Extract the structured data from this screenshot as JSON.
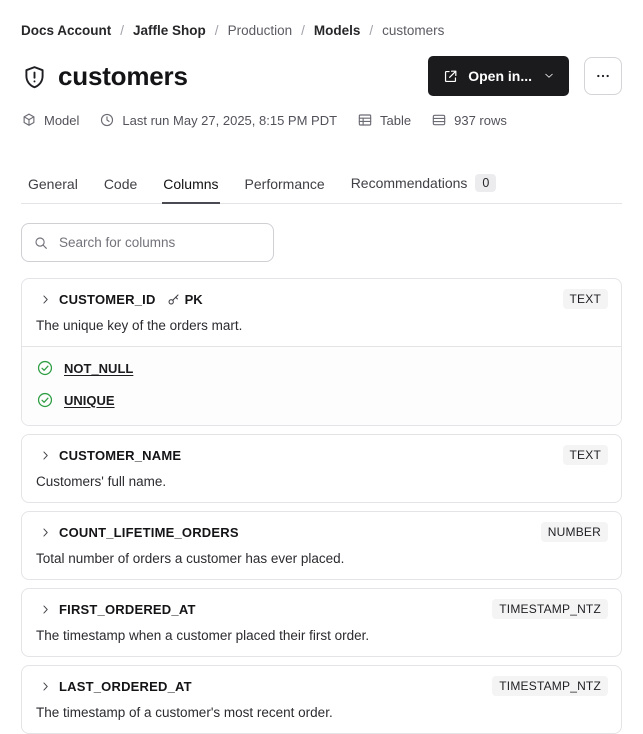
{
  "colors": {
    "accent_button_bg": "#1b1b1e",
    "test_pass_green": "#2f9e44",
    "badge_bg": "#f4f4f5",
    "border": "#e4e4e7"
  },
  "breadcrumb": {
    "separator": "/",
    "items": [
      {
        "label": "Docs Account",
        "style": "strong"
      },
      {
        "label": "Jaffle Shop",
        "style": "strong"
      },
      {
        "label": "Production",
        "style": "muted"
      },
      {
        "label": "Models",
        "style": "strong"
      },
      {
        "label": "customers",
        "style": "muted"
      }
    ]
  },
  "header": {
    "title": "customers",
    "title_icon": "shield-alert-icon",
    "open_in": {
      "label": "Open in...",
      "icon": "external-link-icon",
      "chevron": "chevron-down-icon"
    },
    "more_button_icon": "ellipsis-icon",
    "meta": [
      {
        "icon": "cube-icon",
        "label": "Model"
      },
      {
        "icon": "clock-icon",
        "label": "Last run May 27, 2025, 8:15 PM PDT"
      },
      {
        "icon": "table-icon",
        "label": "Table"
      },
      {
        "icon": "database-icon",
        "label": "937 rows"
      }
    ]
  },
  "tabs": {
    "items": [
      {
        "label": "General",
        "active": false
      },
      {
        "label": "Code",
        "active": false
      },
      {
        "label": "Columns",
        "active": true
      },
      {
        "label": "Performance",
        "active": false
      },
      {
        "label": "Recommendations",
        "active": false,
        "badge": "0"
      }
    ]
  },
  "search": {
    "placeholder": "Search for columns",
    "icon": "search-icon"
  },
  "columns": [
    {
      "name": "CUSTOMER_ID",
      "primary_key": "PK",
      "type": "TEXT",
      "description": "The unique key of the orders mart.",
      "tests": [
        "NOT_NULL",
        "UNIQUE"
      ]
    },
    {
      "name": "CUSTOMER_NAME",
      "type": "TEXT",
      "description": "Customers' full name.",
      "tests": []
    },
    {
      "name": "COUNT_LIFETIME_ORDERS",
      "type": "NUMBER",
      "description": "Total number of orders a customer has ever placed.",
      "tests": []
    },
    {
      "name": "FIRST_ORDERED_AT",
      "type": "TIMESTAMP_NTZ",
      "description": "The timestamp when a customer placed their first order.",
      "tests": []
    },
    {
      "name": "LAST_ORDERED_AT",
      "type": "TIMESTAMP_NTZ",
      "description": "The timestamp of a customer's most recent order.",
      "tests": []
    }
  ]
}
